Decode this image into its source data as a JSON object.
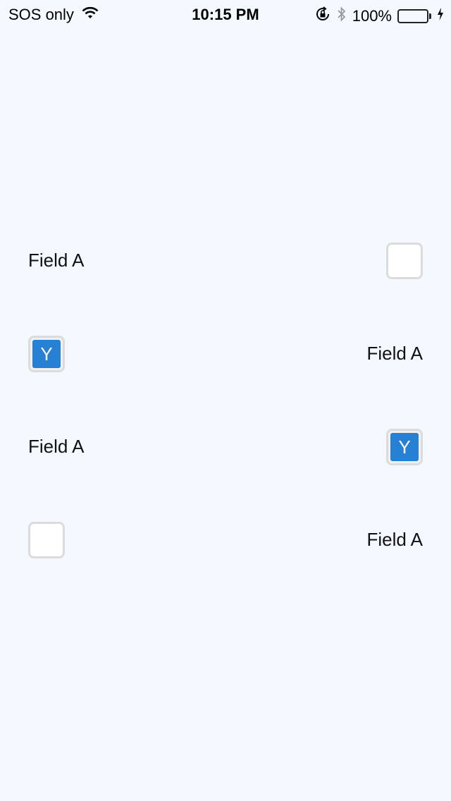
{
  "status_bar": {
    "carrier": "SOS only",
    "time": "10:15 PM",
    "battery_percent": "100%",
    "battery_level": 1.0,
    "icons": [
      "wifi-icon",
      "rotation-lock-icon",
      "bluetooth-icon",
      "battery-icon",
      "charging-icon"
    ]
  },
  "form": {
    "rows": [
      {
        "label": "Field A",
        "checked": false,
        "check_text": ""
      },
      {
        "label": "Field A",
        "checked": true,
        "check_text": "Y"
      },
      {
        "label": "Field A",
        "checked": true,
        "check_text": "Y"
      },
      {
        "label": "Field A",
        "checked": false,
        "check_text": ""
      }
    ]
  },
  "colors": {
    "background": "#f3f9fe",
    "accent": "#2680d4",
    "checkbox_border": "#dcdcdc",
    "battery_fill": "#4cd964"
  }
}
